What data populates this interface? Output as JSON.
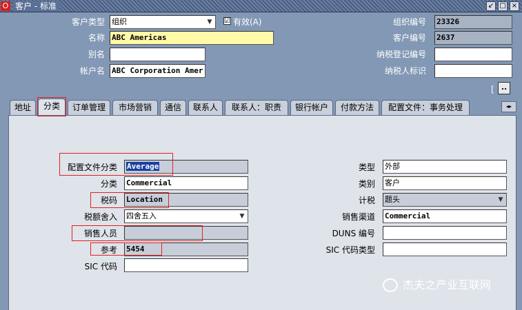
{
  "window": {
    "title": "客户 - 标准",
    "app_badge": "O",
    "buttons": [
      "↙",
      "□",
      "×"
    ]
  },
  "header": {
    "customer_type_label": "客户类型",
    "customer_type_value": "组织",
    "active_label": "有效(A)",
    "active_checked": "☑",
    "name_label": "名称",
    "name_value": "ABC Americas",
    "alias_label": "别名",
    "alias_value": "",
    "account_name_label": "帐户名",
    "account_name_value": "ABC Corporation Amer",
    "org_number_label": "组织编号",
    "org_number_value": "23326",
    "customer_number_label": "客户编号",
    "customer_number_value": "2637",
    "tax_reg_label": "纳税登记编号",
    "tax_reg_value": "",
    "taxpayer_id_label": "纳税人标识",
    "taxpayer_id_value": "",
    "lov_bracket": "[",
    "lov_button": ".."
  },
  "tabs": [
    {
      "label": "地址"
    },
    {
      "label": "分类",
      "active": true
    },
    {
      "label": "订单管理"
    },
    {
      "label": "市场营销"
    },
    {
      "label": "通信"
    },
    {
      "label": "联系人"
    },
    {
      "label": "联系人：职责"
    },
    {
      "label": "银行帐户"
    },
    {
      "label": "付款方法"
    },
    {
      "label": "配置文件：事务处理"
    }
  ],
  "tab_scroll": "◂▸",
  "classification": {
    "profile_class_label": "配置文件分类",
    "profile_class_value": "Average",
    "category_label": "分类",
    "category_value": "Commercial",
    "tax_code_label": "税码",
    "tax_code_value": "Location",
    "tax_rounding_label": "税额舍入",
    "tax_rounding_value": "四舍五入",
    "salesperson_label": "销售人员",
    "salesperson_value": "",
    "reference_label": "参考",
    "reference_value": "5454",
    "sic_code_label": "SIC 代码",
    "sic_code_value": "",
    "type_label": "类型",
    "type_value": "外部",
    "class_label": "类别",
    "class_value": "客户",
    "tax_calc_label": "计税",
    "tax_calc_value": "题头",
    "sales_channel_label": "销售渠道",
    "sales_channel_value": "Commercial",
    "duns_label": "DUNS 编号",
    "duns_value": "",
    "sic_code_type_label": "SIC 代码类型",
    "sic_code_type_value": ""
  },
  "watermark": {
    "text": "杰夫之产业互联网"
  },
  "colors": {
    "background": "#8298b4",
    "panel": "#dfe3ea",
    "required_field": "#fffaa8",
    "highlight": "#e02020",
    "selection": "#1a3fa0"
  }
}
